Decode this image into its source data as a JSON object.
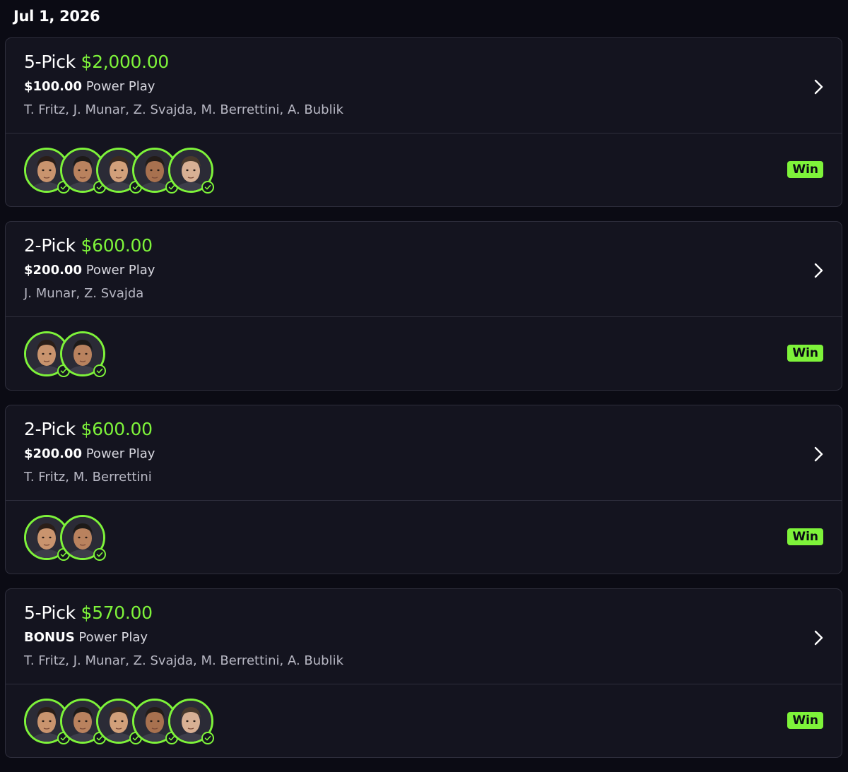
{
  "date_heading": "Jul 1, 2026",
  "accent_color": "#7ef33a",
  "cards": [
    {
      "pick_label": "5-Pick",
      "payout": "$2,000.00",
      "stake_amount": "$100.00",
      "play_type": "Power Play",
      "players": "T. Fritz, J. Munar, Z. Svajda, M. Berrettini, A. Bublik",
      "avatar_count": 5,
      "result": "Win"
    },
    {
      "pick_label": "2-Pick",
      "payout": "$600.00",
      "stake_amount": "$200.00",
      "play_type": "Power Play",
      "players": "J. Munar, Z. Svajda",
      "avatar_count": 2,
      "result": "Win"
    },
    {
      "pick_label": "2-Pick",
      "payout": "$600.00",
      "stake_amount": "$200.00",
      "play_type": "Power Play",
      "players": "T. Fritz, M. Berrettini",
      "avatar_count": 2,
      "result": "Win"
    },
    {
      "pick_label": "5-Pick",
      "payout": "$570.00",
      "stake_amount": "BONUS",
      "play_type": "Power Play",
      "players": "T. Fritz, J. Munar, Z. Svajda, M. Berrettini, A. Bublik",
      "avatar_count": 5,
      "result": "Win"
    }
  ]
}
